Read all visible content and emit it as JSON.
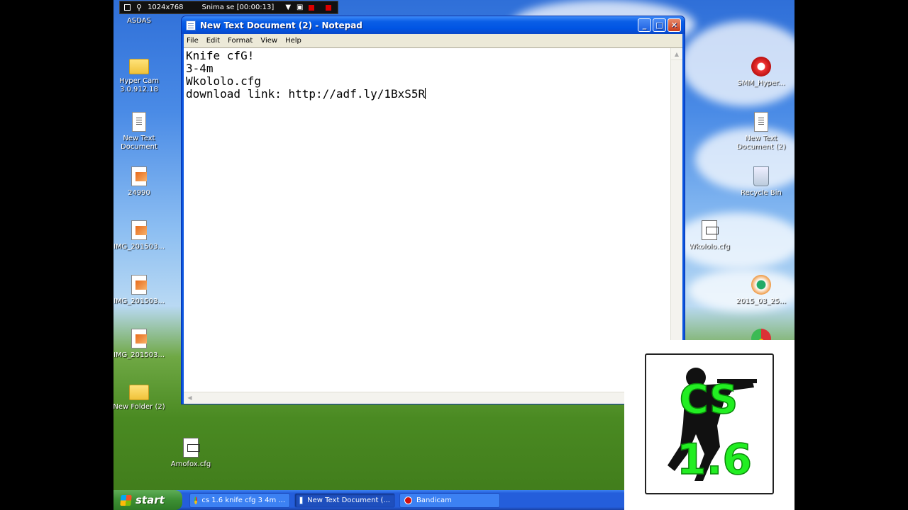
{
  "recorder": {
    "resolution": "1024x768",
    "status": "Snima se [00:00:13]"
  },
  "desktop_left": [
    {
      "label": "ASDAS",
      "icon": "folder-icon"
    },
    {
      "label": "Hyper Cam 3.0.912.18",
      "icon": "folder-icon"
    },
    {
      "label": "New Text Document",
      "icon": "text-document-icon"
    },
    {
      "label": "24990",
      "icon": "image-file-icon"
    },
    {
      "label": "IMG_201503...",
      "icon": "image-file-icon"
    },
    {
      "label": "IMG_201503...",
      "icon": "image-file-icon"
    },
    {
      "label": "IMG_201503...",
      "icon": "image-file-icon"
    },
    {
      "label": "New Folder (2)",
      "icon": "folder-icon"
    },
    {
      "label": "Amofox.cfg",
      "icon": "cfg-file-icon"
    }
  ],
  "desktop_right": [
    {
      "label": "SMM_Hyper...",
      "icon": "record-icon"
    },
    {
      "label": "New Text Document (2)",
      "icon": "text-document-icon"
    },
    {
      "label": "Recycle Bin",
      "icon": "recycle-bin-icon"
    },
    {
      "label": "Wkololo.cfg",
      "icon": "cfg-file-icon"
    },
    {
      "label": "2015_03_25...",
      "icon": "media-file-icon"
    }
  ],
  "notepad": {
    "title": "New Text Document (2) - Notepad",
    "menu": [
      "File",
      "Edit",
      "Format",
      "View",
      "Help"
    ],
    "lines": [
      "Knife cfG!",
      "3-4m",
      "Wkololo.cfg",
      "download link: http://adf.ly/1BxS5R"
    ]
  },
  "taskbar": {
    "start_label": "start",
    "tasks": [
      {
        "label": "cs 1.6 knife cfg 3 4m ...",
        "color": "#e8b030"
      },
      {
        "label": "New Text Document (...",
        "color": "#5a8ee0"
      },
      {
        "label": "Bandicam",
        "color": "#d01010"
      }
    ]
  },
  "logo": {
    "top": "CS",
    "bottom": "1.6",
    "text_color": "#22ee22"
  }
}
